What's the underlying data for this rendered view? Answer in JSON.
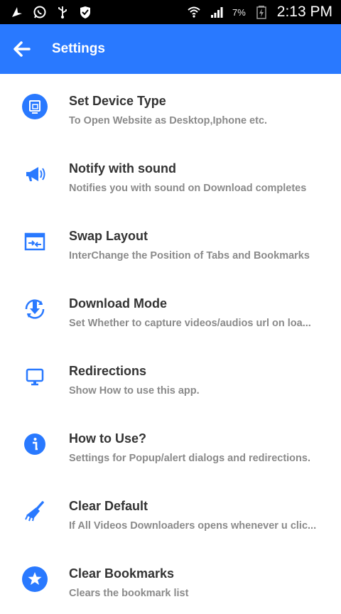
{
  "status_bar": {
    "battery_percent": "7%",
    "time": "2:13 PM",
    "icons": [
      "navigation-icon",
      "whatsapp-icon",
      "usb-icon",
      "shield-icon",
      "wifi-icon",
      "signal-icon",
      "battery-icon"
    ]
  },
  "app_bar": {
    "title": "Settings",
    "back_icon": "arrow-left-icon",
    "color": "#2979ff"
  },
  "settings": [
    {
      "title": "Set Device Type",
      "subtitle": "To Open Website as Desktop,Iphone etc.",
      "icon": "device-type-icon"
    },
    {
      "title": "Notify with sound",
      "subtitle": "Notifies you with sound on Download completes",
      "icon": "megaphone-icon"
    },
    {
      "title": "Swap Layout",
      "subtitle": "InterChange the Position of Tabs and Bookmarks",
      "icon": "swap-layout-icon"
    },
    {
      "title": "Download Mode",
      "subtitle": "Set Whether to capture videos/audios url on loa...",
      "icon": "download-mode-icon"
    },
    {
      "title": "Redirections",
      "subtitle": "Show How to use this app.",
      "icon": "monitor-icon"
    },
    {
      "title": "How to Use?",
      "subtitle": "Settings for Popup/alert dialogs and redirections.",
      "icon": "info-icon"
    },
    {
      "title": "Clear Default",
      "subtitle": "If All Videos Downloaders opens whenever u clic...",
      "icon": "brush-icon"
    },
    {
      "title": "Clear Bookmarks",
      "subtitle": "Clears the bookmark list",
      "icon": "star-icon"
    }
  ]
}
